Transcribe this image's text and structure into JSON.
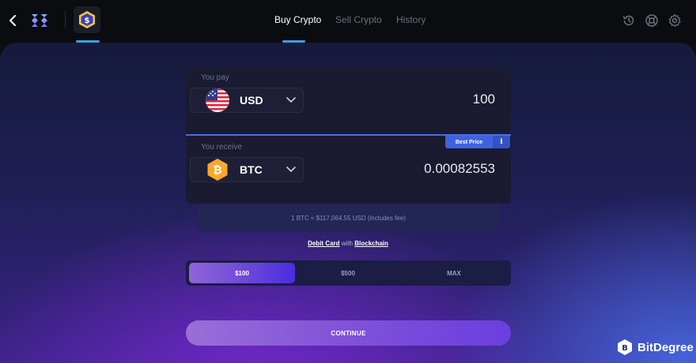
{
  "nav": {
    "tabs": [
      {
        "label": "Buy Crypto",
        "active": true
      },
      {
        "label": "Sell Crypto",
        "active": false
      },
      {
        "label": "History",
        "active": false
      }
    ],
    "icons": [
      "back-icon",
      "exodus-logo",
      "dollar-coin-icon",
      "history-icon",
      "support-icon",
      "settings-icon"
    ]
  },
  "pay": {
    "label": "You pay",
    "currency": "USD",
    "amount": "100"
  },
  "receive": {
    "label": "You receive",
    "currency": "BTC",
    "amount": "0.00082553",
    "badge": "Best Price",
    "info": "i"
  },
  "rate": "1 BTC ≈ $117,064.55 USD (includes fee)",
  "method": {
    "card": "Debit Card",
    "with": "with",
    "chain": "Blockchain"
  },
  "amount_presets": [
    {
      "label": "$100",
      "active": true
    },
    {
      "label": "$500",
      "active": false
    },
    {
      "label": "MAX",
      "active": false
    }
  ],
  "continue_label": "CONTINUE",
  "watermark": "BitDegree",
  "colors": {
    "accent_blue": "#3b9fe6",
    "best_price_blue": "#3f63e0",
    "btc_orange": "#f7a82b"
  }
}
